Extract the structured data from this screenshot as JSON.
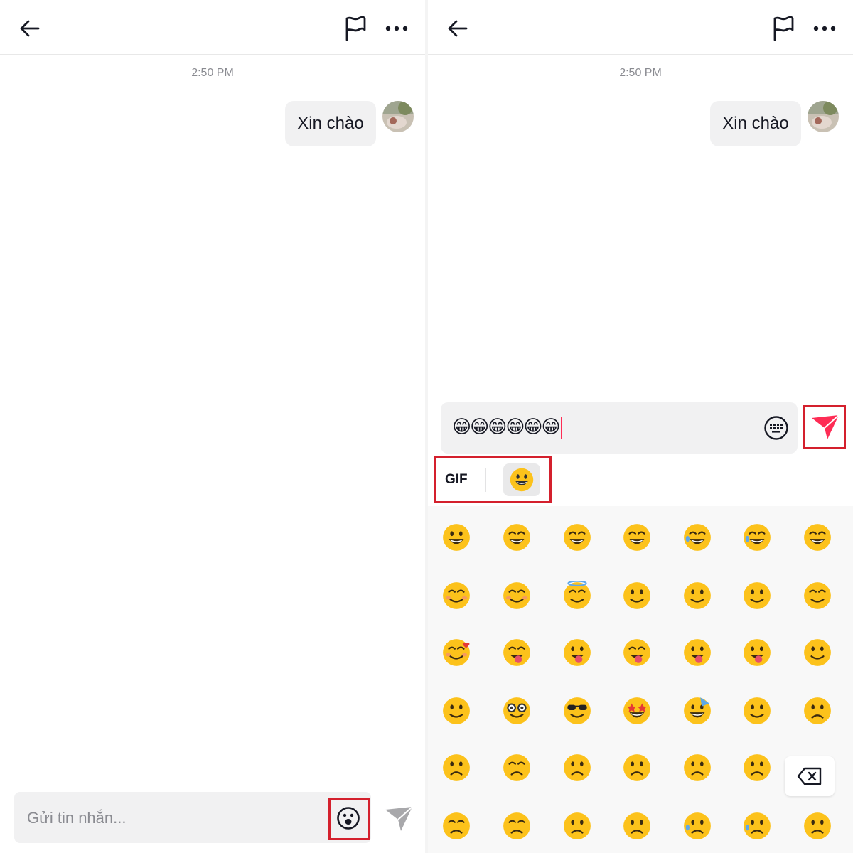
{
  "left_panel": {
    "timestamp": "2:50 PM",
    "message": "Xin chào",
    "input_placeholder": "Gửi tin nhắn...",
    "icons": [
      "back-arrow-icon",
      "flag-icon",
      "more-icon",
      "emoji-icon",
      "send-icon"
    ],
    "send_color": "#a8a8ab"
  },
  "right_panel": {
    "timestamp": "2:50 PM",
    "message": "Xin chào",
    "input_value": "😁😁😁😁😁😁",
    "gif_tab": "GIF",
    "icons": [
      "back-arrow-icon",
      "flag-icon",
      "more-icon",
      "keyboard-icon",
      "send-icon",
      "backspace-icon"
    ],
    "send_color": "#fe2c55",
    "emoji_rows": [
      [
        "grinning",
        "smile",
        "grin",
        "laughing",
        "sweat-smile",
        "joy",
        "rofl"
      ],
      [
        "relaxed",
        "blush",
        "innocent",
        "slight-smile",
        "upside-down",
        "wink",
        "relieved"
      ],
      [
        "smiling-hearts",
        "yum",
        "tongue",
        "squint-tongue",
        "wink-tongue",
        "zany",
        "raised-eyebrow"
      ],
      [
        "monocle",
        "nerd",
        "sunglasses",
        "star-struck",
        "partying",
        "smirk",
        "unamused"
      ],
      [
        "disappointed",
        "pensive",
        "worried",
        "confused",
        "slight-frown",
        "frowning"
      ],
      [
        "confounded",
        "tired",
        "weary",
        "pleading",
        "cry",
        "sob",
        "triumph"
      ]
    ]
  },
  "colors": {
    "highlight_box": "#d4202d",
    "accent": "#fe2c55",
    "emoji_yellow": "#fcc21b"
  }
}
